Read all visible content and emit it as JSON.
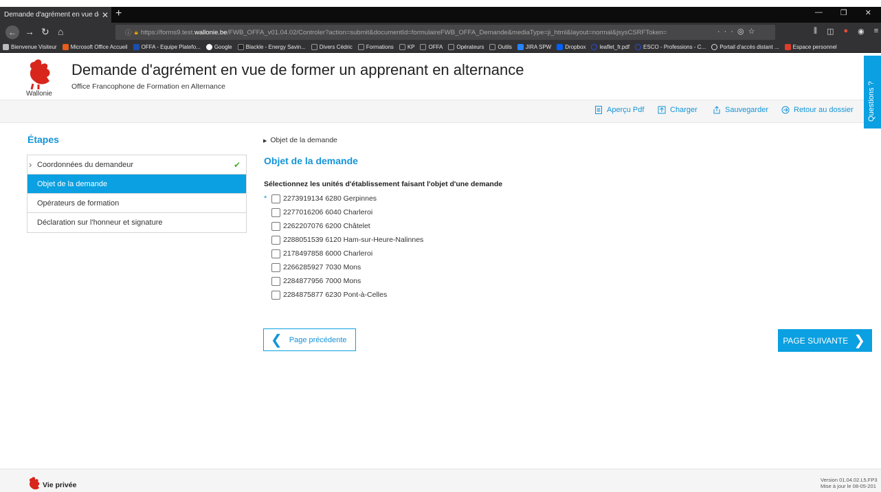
{
  "browser": {
    "tab_title": "Demande d'agrément en vue de fo",
    "tab_close": "✕",
    "new_tab": "+",
    "url_scheme": "https://forms9.test.",
    "url_host": "wallonie.be",
    "url_path": "/FWB_OFFA_v01.04.02/Controler?action=submit&documentId=formulaireFWB_OFFA_Demande&mediaType=ji_html&layout=normal&jsysCSRFToken=",
    "bookmarks": [
      {
        "label": "Bienvenue Visiteur",
        "color": "#bbbbbb"
      },
      {
        "label": "Microsoft Office Accueil",
        "color": "#e85d1a"
      },
      {
        "label": "OFFA - Equipe Platefo...",
        "color": "#1a4fb0"
      },
      {
        "label": "Google",
        "color": "#ffffff"
      },
      {
        "label": "Blackle - Energy Savin...",
        "color": "#222222"
      },
      {
        "label": "Divers Cédric",
        "color": "#9a9a9a"
      },
      {
        "label": "Formations",
        "color": "#9a9a9a"
      },
      {
        "label": "KP",
        "color": "#9a9a9a"
      },
      {
        "label": "OFFA",
        "color": "#9a9a9a"
      },
      {
        "label": "Opérateurs",
        "color": "#9a9a9a"
      },
      {
        "label": "Outils",
        "color": "#9a9a9a"
      },
      {
        "label": "JIRA SPW",
        "color": "#2684ff"
      },
      {
        "label": "Dropbox",
        "color": "#0061fe"
      },
      {
        "label": "leaflet_fr.pdf",
        "color": "#2b4fe0"
      },
      {
        "label": "ESCO - Professions - C...",
        "color": "#2b4fe0"
      },
      {
        "label": "Portail d'accès distant ...",
        "color": "#dddddd"
      },
      {
        "label": "Espace personnel",
        "color": "#e03c2b"
      }
    ]
  },
  "header": {
    "logo_text": "Wallonie",
    "title": "Demande d'agrément en vue de former un apprenant en alternance",
    "subtitle": "Office Francophone de Formation en Alternance",
    "questions_tab": "Questions ?"
  },
  "toolbar": {
    "pdf_label": "Aperçu Pdf",
    "load_label": "Charger",
    "save_label": "Sauvegarder",
    "back_label": "Retour au dossier"
  },
  "sidebar": {
    "title": "Étapes",
    "items": [
      {
        "label": "Coordonnées du demandeur"
      },
      {
        "label": "Objet de la demande"
      },
      {
        "label": "Opérateurs de formation"
      },
      {
        "label": "Déclaration sur l'honneur et signature"
      }
    ]
  },
  "main": {
    "breadcrumb": "Objet de la demande",
    "section_title": "Objet de la demande",
    "question": "Sélectionnez les unités d'établissement faisant l'objet d'une demande",
    "required_marker": "*",
    "options": [
      "2273919134 6280 Gerpinnes",
      "2277016206 6040 Charleroi",
      "2262207076 6200 Châtelet",
      "2288051539 6120 Ham-sur-Heure-Nalinnes",
      "2178497858 6000 Charleroi",
      "2266285927 7030 Mons",
      "2284877956 7000 Mons",
      "2284875877 6230 Pont-à-Celles"
    ],
    "prev_label": "Page précédente",
    "next_label": "PAGE SUIVANTE"
  },
  "footer": {
    "privacy": "Vie privée",
    "version_line1": "Version 01.04.02.L5.FP3",
    "version_line2": "Mise à jour le 08-05-201"
  },
  "colors": {
    "accent": "#0aa0e1",
    "link": "#1494d8",
    "check": "#4caf2c",
    "logo_red": "#d8261c"
  }
}
